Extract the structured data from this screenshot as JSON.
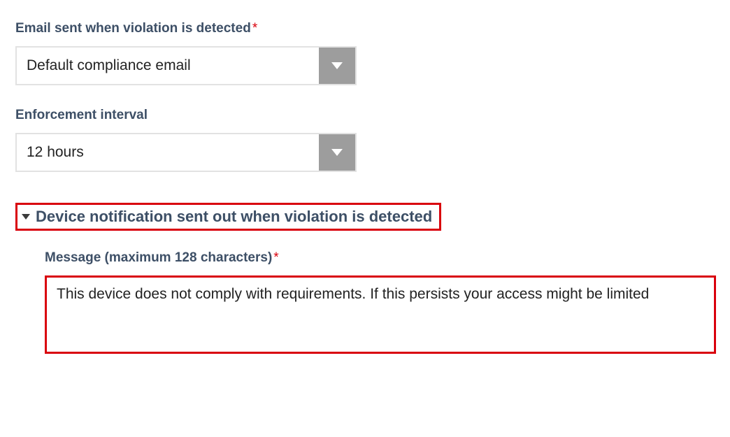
{
  "emailField": {
    "label": "Email sent when violation is detected",
    "value": "Default compliance email"
  },
  "intervalField": {
    "label": "Enforcement interval",
    "value": "12 hours"
  },
  "section": {
    "title": "Device notification sent out when violation is detected"
  },
  "messageField": {
    "label": "Message (maximum 128 characters)",
    "value": "This device does not comply with requirements. If this persists your access might be limited"
  }
}
